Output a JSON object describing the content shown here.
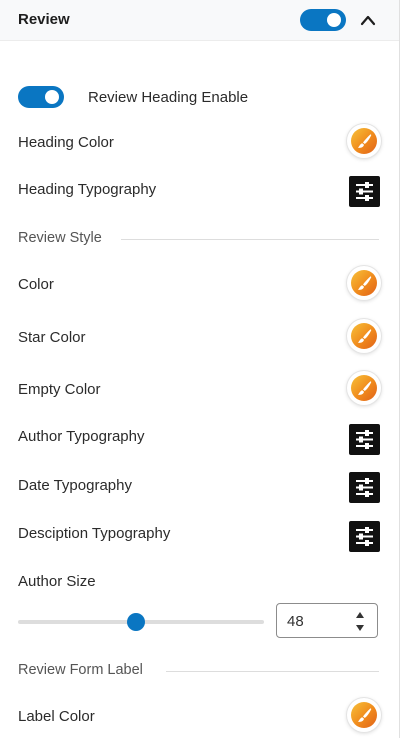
{
  "panel": {
    "title": "Review",
    "enabled": true
  },
  "review_heading": {
    "enable_label": "Review Heading Enable",
    "enabled": true,
    "color_label": "Heading Color",
    "typography_label": "Heading Typography"
  },
  "review_style": {
    "section_label": "Review Style",
    "color_label": "Color",
    "star_color_label": "Star Color",
    "empty_color_label": "Empty Color",
    "author_typography_label": "Author Typography",
    "date_typography_label": "Date Typography",
    "description_typography_label": "Desciption Typography",
    "author_size": {
      "label": "Author Size",
      "value": "48",
      "slider_fraction": 0.48
    }
  },
  "review_form": {
    "section_label": "Review Form Label",
    "label_color_label": "Label Color"
  },
  "colors": {
    "accent": "#0a76c2",
    "swatch_gradient_start": "#f7c23a",
    "swatch_gradient_end": "#e0621a"
  },
  "icons": {
    "collapse": "chevron-up-icon",
    "color_picker": "paintbrush-icon",
    "typography": "sliders-icon"
  }
}
